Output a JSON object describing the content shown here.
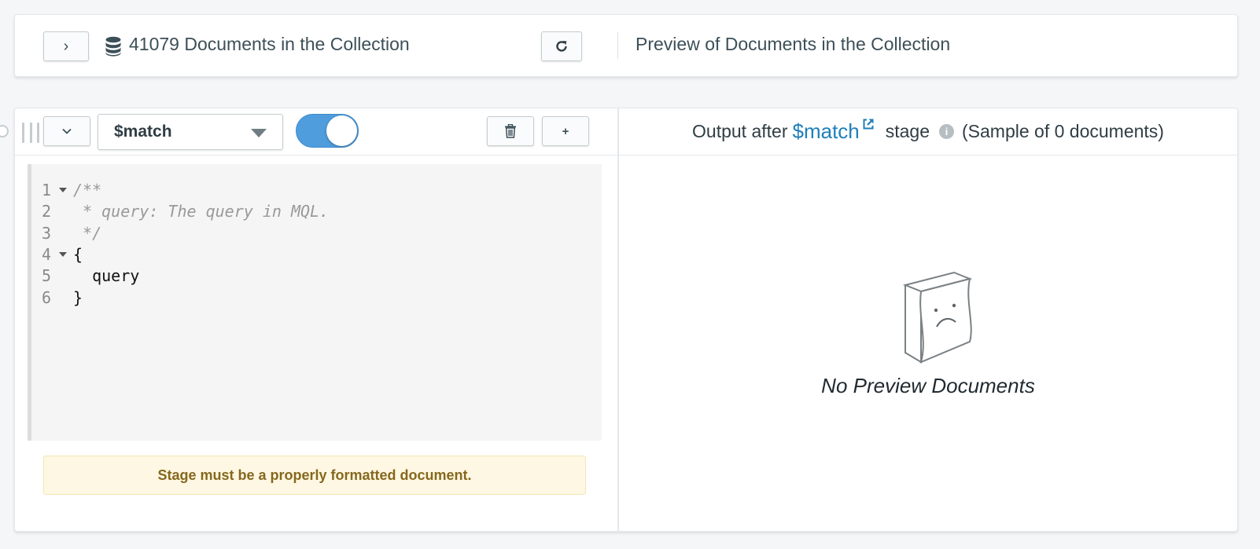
{
  "summary": {
    "document_count_text": "41079 Documents in the Collection",
    "preview_title": "Preview of Documents in the Collection",
    "expand_glyph": "›",
    "icons": {
      "database": "database-icon",
      "refresh": "refresh-icon"
    }
  },
  "stage": {
    "operator": "$match",
    "enabled": true,
    "add_label": "+",
    "icons": {
      "delete": "trash-icon",
      "collapse": "chevron-down-icon",
      "drag": "drag-handle-icon"
    },
    "editor": {
      "lines": [
        {
          "num": "1",
          "text": "/**",
          "comment": true,
          "fold": true
        },
        {
          "num": "2",
          "text": " * query: The query in MQL.",
          "comment": true,
          "fold": false
        },
        {
          "num": "3",
          "text": " */",
          "comment": true,
          "fold": false
        },
        {
          "num": "4",
          "text": "{",
          "comment": false,
          "fold": true
        },
        {
          "num": "5",
          "text": "  query",
          "comment": false,
          "fold": false
        },
        {
          "num": "6",
          "text": "}",
          "comment": false,
          "fold": false
        }
      ]
    },
    "warning": "Stage must be a properly formatted document."
  },
  "preview": {
    "prefix": "Output after",
    "operator": "$match",
    "stage_word": "stage",
    "sample_text": "(Sample of 0 documents)",
    "empty_text": "No Preview Documents"
  },
  "colors": {
    "accent": "#1f7fb8",
    "toggle_on": "#4f9ddc",
    "warning_bg": "#fef7e3",
    "warning_text": "#86681d"
  }
}
